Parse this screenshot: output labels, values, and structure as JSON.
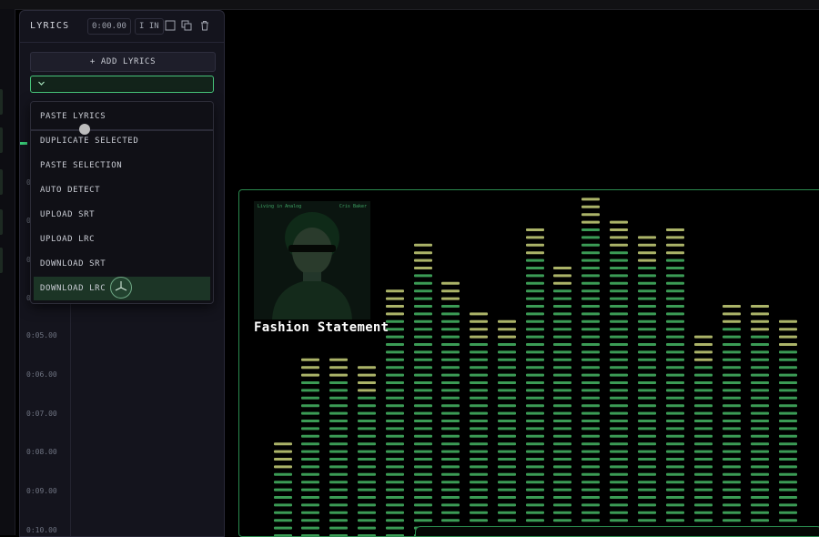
{
  "panel": {
    "title": "LYRICS",
    "time": "0:00.00",
    "in_label": "I IN",
    "add_button": "+ ADD LYRICS",
    "select_icon": "chevron-down-icon"
  },
  "menu": {
    "items": [
      {
        "label": "PASTE LYRICS"
      },
      {
        "label": "DUPLICATE SELECTED"
      },
      {
        "label": "PASTE SELECTION"
      },
      {
        "label": "AUTO DETECT"
      },
      {
        "label": "UPLOAD SRT"
      },
      {
        "label": "UPLOAD LRC"
      },
      {
        "label": "DOWNLOAD SRT"
      },
      {
        "label": "DOWNLOAD LRC"
      }
    ],
    "hovered_index": 7
  },
  "timeline": {
    "timestamps": [
      {
        "label": "0:05.00"
      },
      {
        "label": "0:06.00"
      },
      {
        "label": "0:07.00"
      },
      {
        "label": "0:08.00"
      },
      {
        "label": "0:09.00"
      },
      {
        "label": "0:10.00"
      }
    ],
    "partial_labels": [
      "0:",
      "0:",
      "0:",
      "0:",
      "0:",
      "0:"
    ]
  },
  "stage": {
    "song_title": "Fashion Statement",
    "album_caption_left": "Living in Analog",
    "album_caption_right": "Cris Baker",
    "accent": "#2a8a4e"
  },
  "colors": {
    "bar_green": "#4fcf72",
    "bar_yellow": "#c9d27a",
    "bar_pink": "#c8a9c8",
    "panel_bg": "#14141d"
  }
}
